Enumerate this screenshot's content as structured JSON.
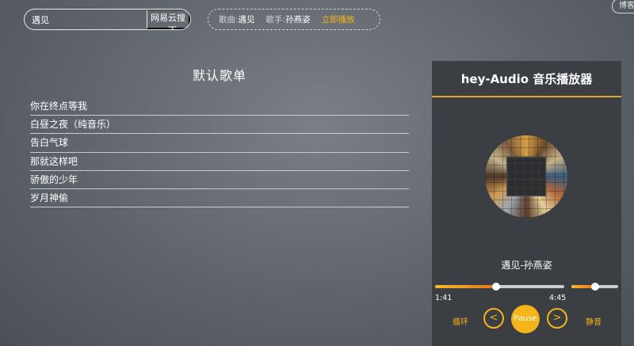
{
  "search": {
    "value": "遇见",
    "button_label": "网易云搜一下"
  },
  "now_playing_bar": {
    "song_label": "歌曲:",
    "song_value": "遇见",
    "singer_label": "歌手:",
    "singer_value": "孙燕姿",
    "play_now_label": "立即播放"
  },
  "blog_button": "博客",
  "playlist": {
    "title": "默认歌单",
    "items": [
      "你在终点等我",
      "白昼之夜（纯音乐）",
      "告白气球",
      "那就这样吧",
      "骄傲的少年",
      "岁月神偷"
    ]
  },
  "player": {
    "title": "hey-Audio 音乐播放器",
    "current_song": "遇见-孙燕姿",
    "time_current": "1:41",
    "time_total": "4:45",
    "progress_fraction": 0.47,
    "volume_fraction": 0.5,
    "loop_label": "循环",
    "prev_label": "<",
    "play_label": "Pause",
    "next_label": ">",
    "mute_label": "静音"
  },
  "colors": {
    "accent": "#f5b417",
    "panel": "#3b3e42"
  }
}
